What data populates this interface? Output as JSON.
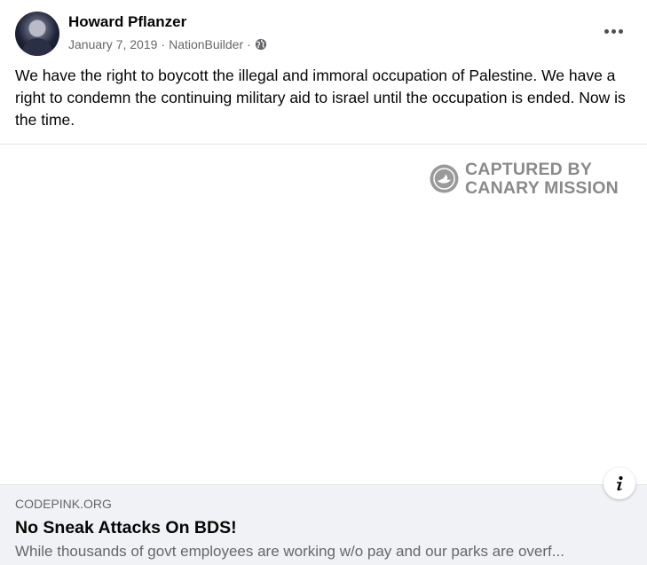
{
  "post": {
    "author_name": "Howard Pflanzer",
    "date": "January 7, 2019",
    "separator": "·",
    "source": "NationBuilder",
    "text": "We have the right to boycott the illegal and immoral occupation of Palestine.  We have a right to condemn the continuing military aid to israel until the occupation is ended. Now is the time.",
    "privacy_icon": "globe-icon",
    "more_icon": "more-options-icon"
  },
  "watermark": {
    "line1": "CAPTURED BY",
    "line2": "CANARY MISSION",
    "color": "#8a8a8a"
  },
  "link_card": {
    "domain": "CODEPINK.ORG",
    "title": "No Sneak Attacks On BDS!",
    "description": "While thousands of govt employees are working w/o pay and our parks are overf...",
    "info_icon": "info-icon"
  },
  "colors": {
    "card_background": "#f0f2f5",
    "secondary_text": "#65676b",
    "primary_text": "#050505"
  }
}
